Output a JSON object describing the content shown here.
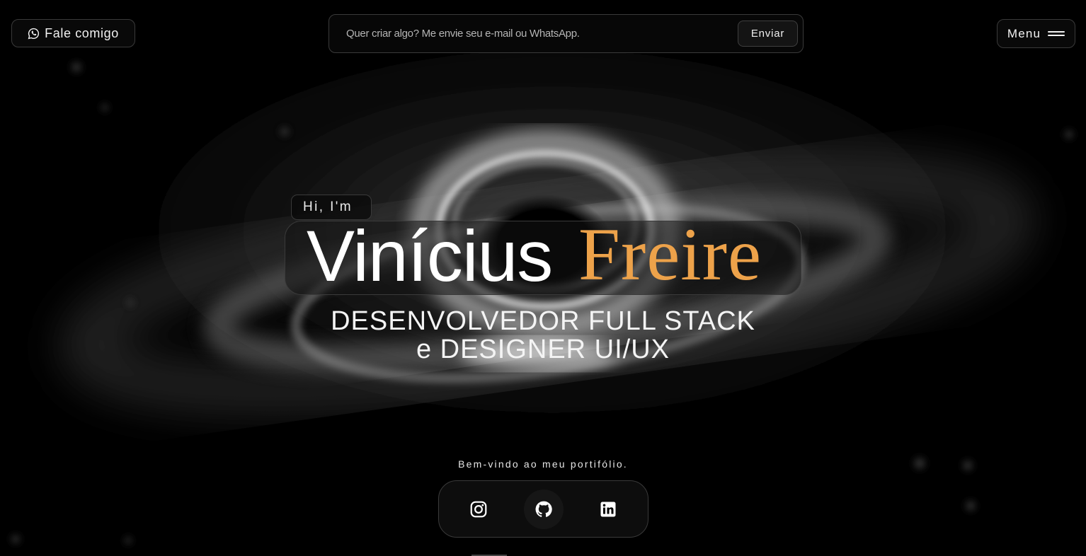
{
  "header": {
    "contact_label": "Fale comigo",
    "contact_icon": "whatsapp-icon",
    "message_placeholder": "Quer criar algo? Me envie seu e-mail ou WhatsApp.",
    "message_value": "",
    "send_label": "Enviar",
    "menu_label": "Menu",
    "menu_icon": "hamburger-icon"
  },
  "hero": {
    "greeting": "Hi, I'm",
    "first_name": "Vinícius",
    "last_name": "Freire",
    "role_line1": "DESENVOLVEDOR FULL STACK",
    "role_line2": "e DESIGNER UI/UX",
    "welcome": "Bem-vindo ao meu portifólio."
  },
  "social": {
    "items": [
      {
        "name": "instagram",
        "icon": "instagram-icon"
      },
      {
        "name": "github",
        "icon": "github-icon"
      },
      {
        "name": "linkedin",
        "icon": "linkedin-icon"
      }
    ]
  },
  "colors": {
    "background": "#000000",
    "accent": "#eda24a",
    "border": "#3a3a3a",
    "text": "#ffffff"
  }
}
